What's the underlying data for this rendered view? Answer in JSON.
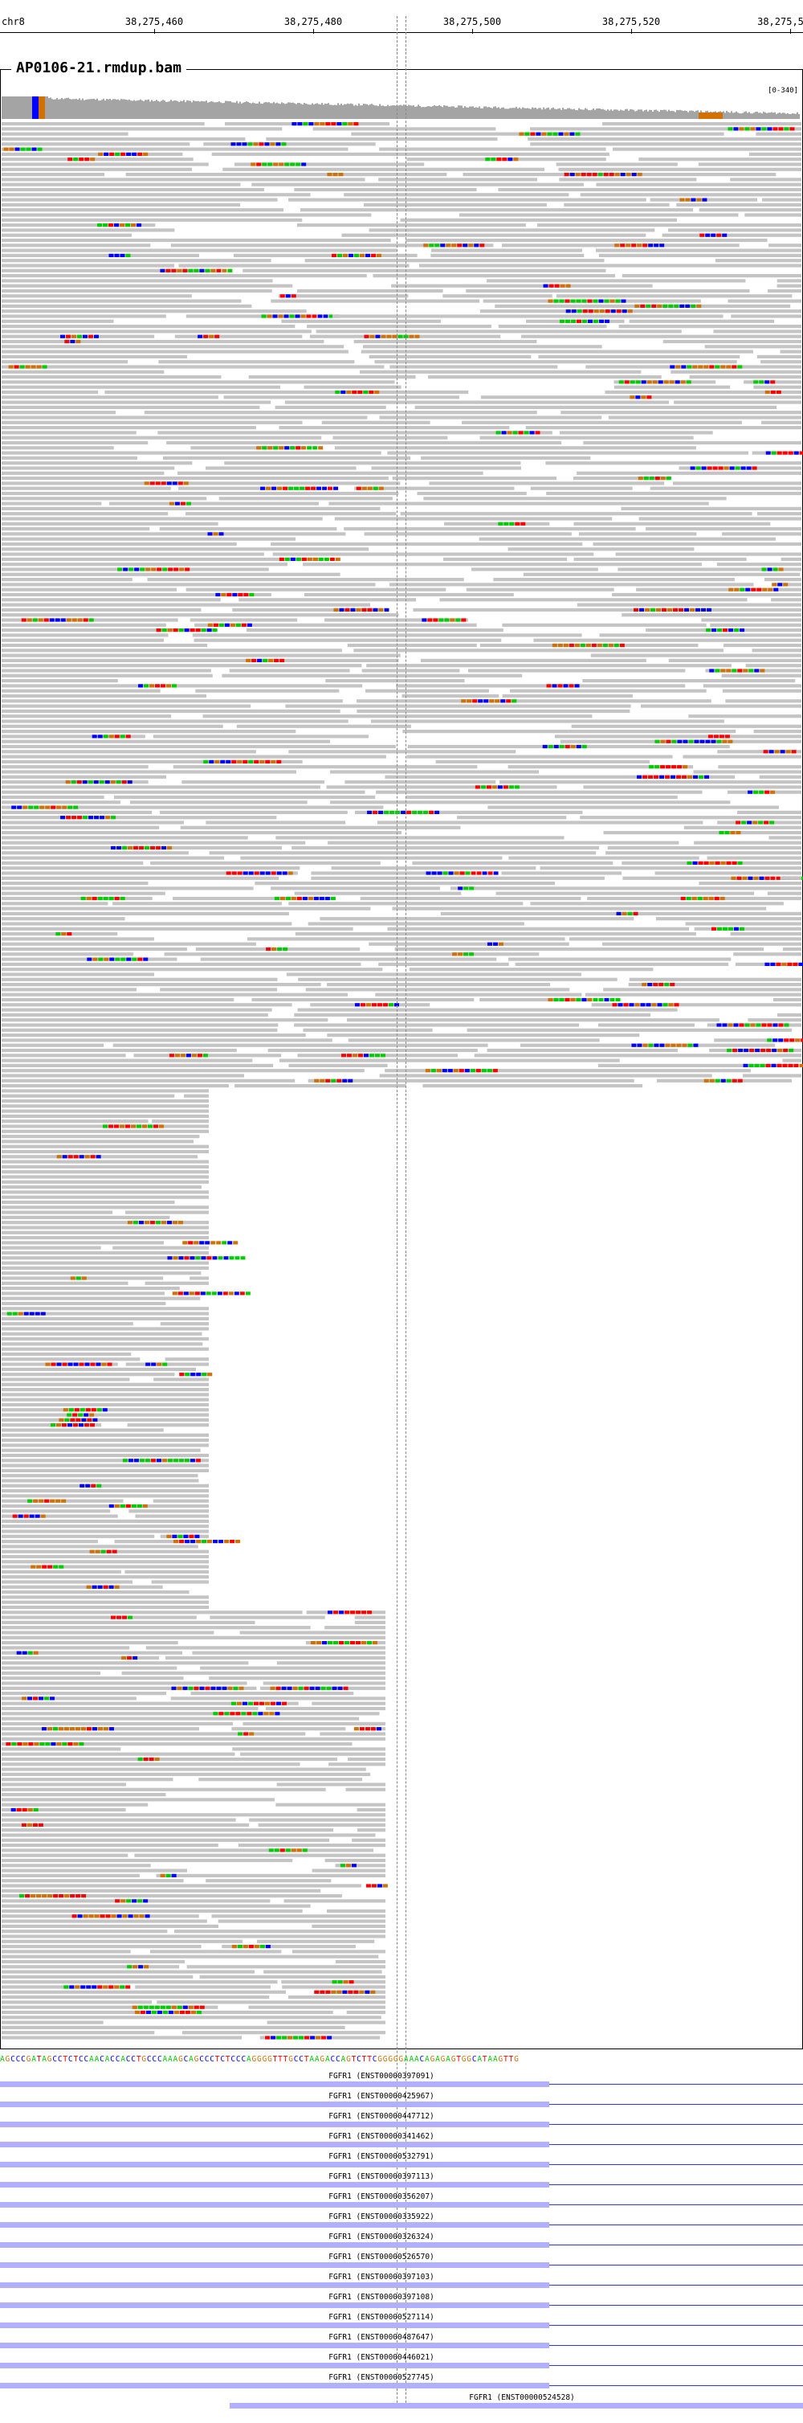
{
  "ruler": {
    "chrom": "chr8",
    "labels": [
      "38,275,460",
      "38,275,480",
      "38,275,500",
      "38,275,520",
      "38,275,5"
    ]
  },
  "track": {
    "title": "AP0106-21.rmdup.bam",
    "range": "[0-340]"
  },
  "sequence": "AGCCCGATAGCCTCTCCAACACCACCTGCCCAAAGCAGCCCTCTCCCAGGGGTTTGCCTAAGACCAGTCTTCGGGGGAAACAGAGAGTGGCATAAGTTG",
  "transcripts": [
    "FGFR1 (ENST00000397091)",
    "FGFR1 (ENST00000425967)",
    "FGFR1 (ENST00000447712)",
    "FGFR1 (ENST00000341462)",
    "FGFR1 (ENST00000532791)",
    "FGFR1 (ENST00000397113)",
    "FGFR1 (ENST00000356207)",
    "FGFR1 (ENST00000335922)",
    "FGFR1 (ENST00000326324)",
    "FGFR1 (ENST00000526570)",
    "FGFR1 (ENST00000397103)",
    "FGFR1 (ENST00000397108)",
    "FGFR1 (ENST00000527114)",
    "FGFR1 (ENST00000487647)",
    "FGFR1 (ENST00000446021)",
    "FGFR1 (ENST00000527745)",
    "FGFR1 (ENST00000524528)"
  ],
  "colors": {
    "read": "#c4c4c4",
    "coverage": "#a4a4a4",
    "base_A": "#00cc00",
    "base_C": "#0000ff",
    "base_G": "#d17105",
    "base_T": "#ff0000",
    "gene": "#b0b0ff",
    "gene_line": "#3333ee"
  },
  "icons": [
    "ruler-tick-mark",
    "center-guide-line"
  ]
}
